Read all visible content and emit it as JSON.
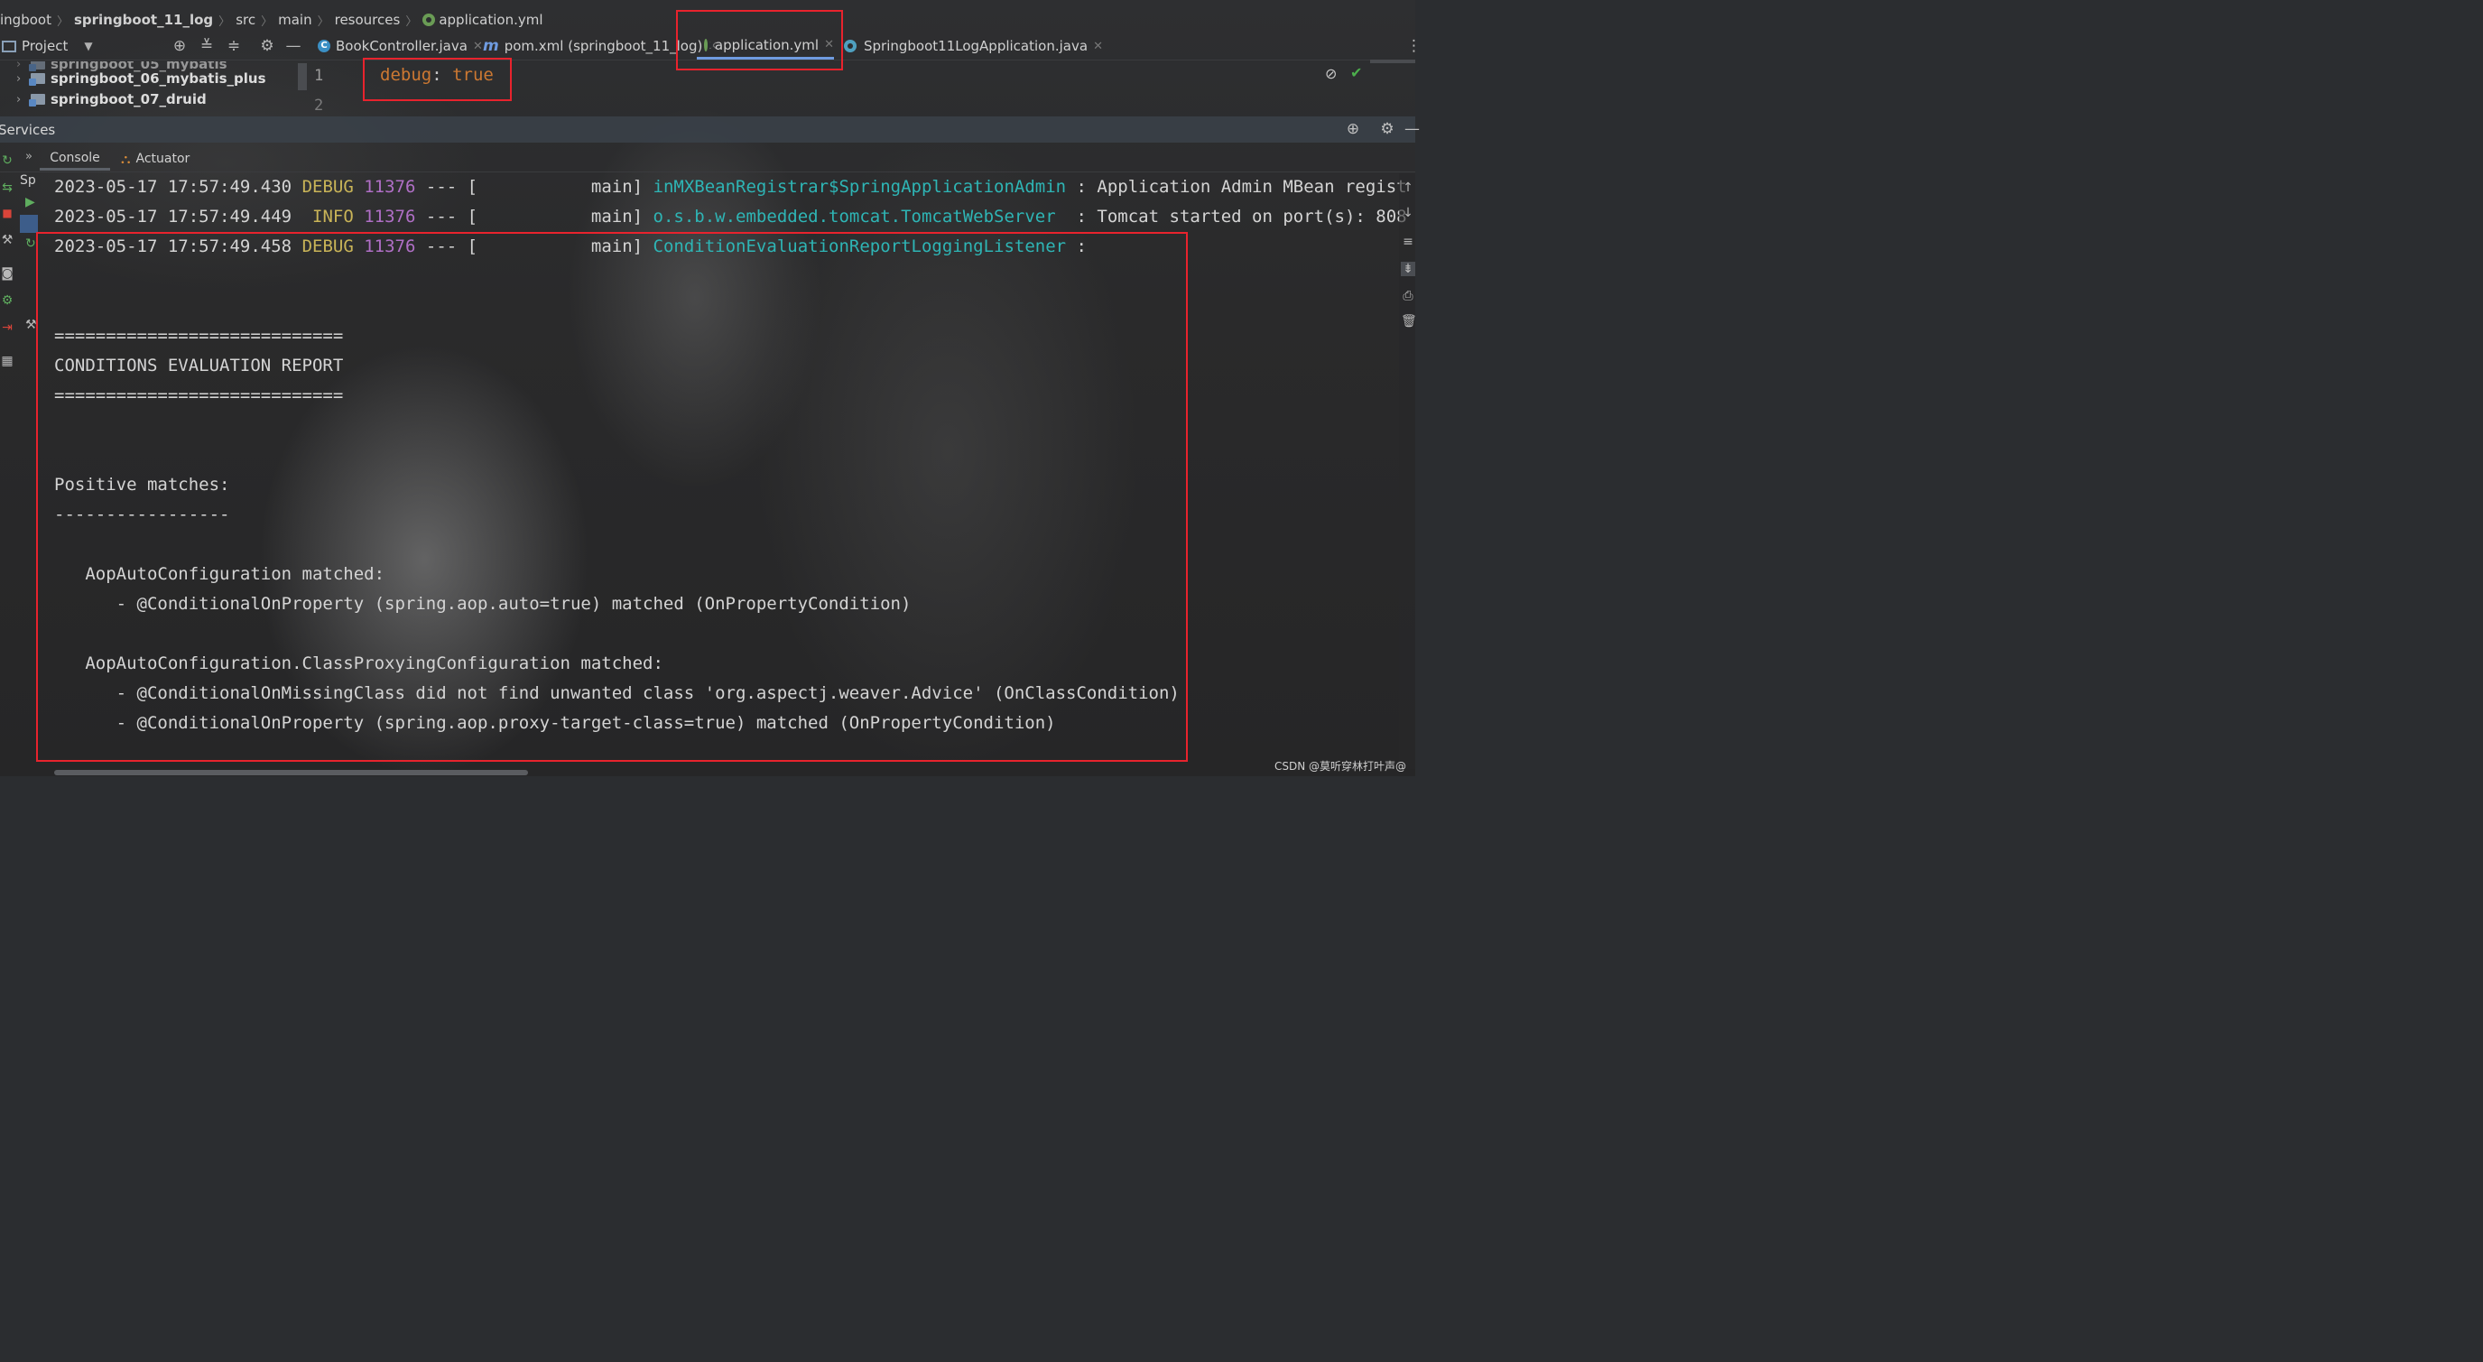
{
  "breadcrumb": {
    "items": [
      "ingboot",
      "springboot_11_log",
      "src",
      "main",
      "resources",
      "application.yml"
    ]
  },
  "project_panel": {
    "label": "Project",
    "tree": [
      {
        "label": "springboot_05_mybatis"
      },
      {
        "label": "springboot_06_mybatis_plus"
      },
      {
        "label": "springboot_07_druid"
      }
    ]
  },
  "tabs": [
    {
      "label": "BookController.java",
      "icon": "class-icon"
    },
    {
      "label": "pom.xml (springboot_11_log)",
      "icon": "maven-icon"
    },
    {
      "label": "application.yml",
      "icon": "yml-icon",
      "active": true
    },
    {
      "label": "Springboot11LogApplication.java",
      "icon": "spring-app-icon"
    }
  ],
  "editor": {
    "line_numbers": [
      "1",
      "2"
    ],
    "code_key": "debug",
    "code_sep": ": ",
    "code_value": "true"
  },
  "services": {
    "title": "Services",
    "console_tab": "Console",
    "actuator_tab": "Actuator",
    "tree_label": "Sp"
  },
  "console": {
    "log_lines": [
      {
        "timestamp": "2023-05-17 17:57:49.430",
        "level": "DEBUG",
        "pid": "11376",
        "thread_sep": "--- [           main]",
        "logger": "inMXBeanRegistrar$SpringApplicationAdmin",
        "message": " : Application Admin MBean regist"
      },
      {
        "timestamp": "2023-05-17 17:57:49.449",
        "level": " INFO",
        "pid": "11376",
        "thread_sep": "--- [           main]",
        "logger": "o.s.b.w.embedded.tomcat.TomcatWebServer ",
        "message": " : Tomcat started on port(s): 808"
      },
      {
        "timestamp": "2023-05-17 17:57:49.458",
        "level": "DEBUG",
        "pid": "11376",
        "thread_sep": "--- [           main]",
        "logger": "ConditionEvaluationReportLoggingListener",
        "message": " :"
      }
    ],
    "report": [
      "============================",
      "CONDITIONS EVALUATION REPORT",
      "============================",
      "Positive matches:",
      "-----------------",
      "   AopAutoConfiguration matched:",
      "      - @ConditionalOnProperty (spring.aop.auto=true) matched (OnPropertyCondition)",
      "   AopAutoConfiguration.ClassProxyingConfiguration matched:",
      "      - @ConditionalOnMissingClass did not find unwanted class 'org.aspectj.weaver.Advice' (OnClassCondition)",
      "      - @ConditionalOnProperty (spring.aop.proxy-target-class=true) matched (OnPropertyCondition)"
    ]
  },
  "watermark": "CSDN @莫听穿林打叶声@",
  "colors": {
    "highlight_box": "#e8232d",
    "logger": "#2eb5b5",
    "pid": "#b06fc6",
    "level": "#c9b458",
    "yaml_key": "#cc7832"
  }
}
